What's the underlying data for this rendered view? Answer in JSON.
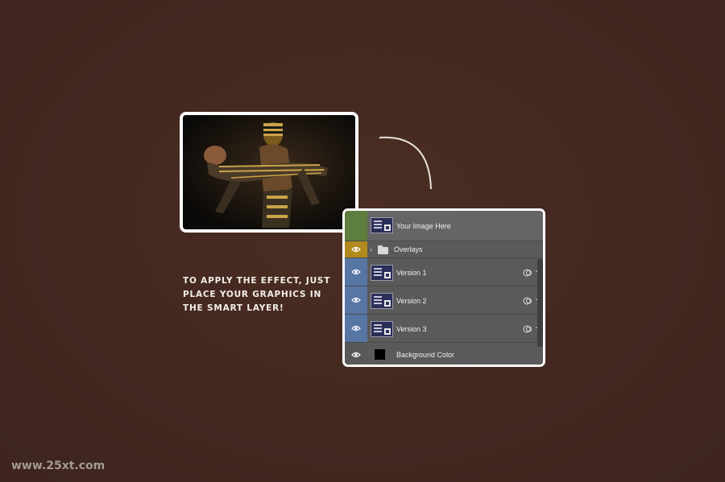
{
  "instruction": {
    "lines": [
      "TO APPLY THE EFFECT, JUST",
      "PLACE YOUR GRAPHICS IN",
      "THE SMART LAYER!"
    ]
  },
  "layers": {
    "items": [
      {
        "label": "Your Image Here",
        "color": "#5e7e3e",
        "type": "smart-object",
        "selected": true
      },
      {
        "label": "Overlays",
        "color": "#b08a1c",
        "type": "group"
      },
      {
        "label": "Version 1",
        "color": "#5776a3",
        "type": "smart-object"
      },
      {
        "label": "Version 2",
        "color": "#5776a3",
        "type": "smart-object"
      },
      {
        "label": "Version 3",
        "color": "#5776a3",
        "type": "smart-object"
      },
      {
        "label": "Background Color",
        "color": "#585858",
        "type": "fill"
      }
    ],
    "folder_chevron": "›",
    "dropdown_chevron": "⌄"
  },
  "watermark": "www.25xt.com",
  "colors": {
    "background": "#45291f",
    "card_border": "#ffffff",
    "panel": "#555555"
  }
}
